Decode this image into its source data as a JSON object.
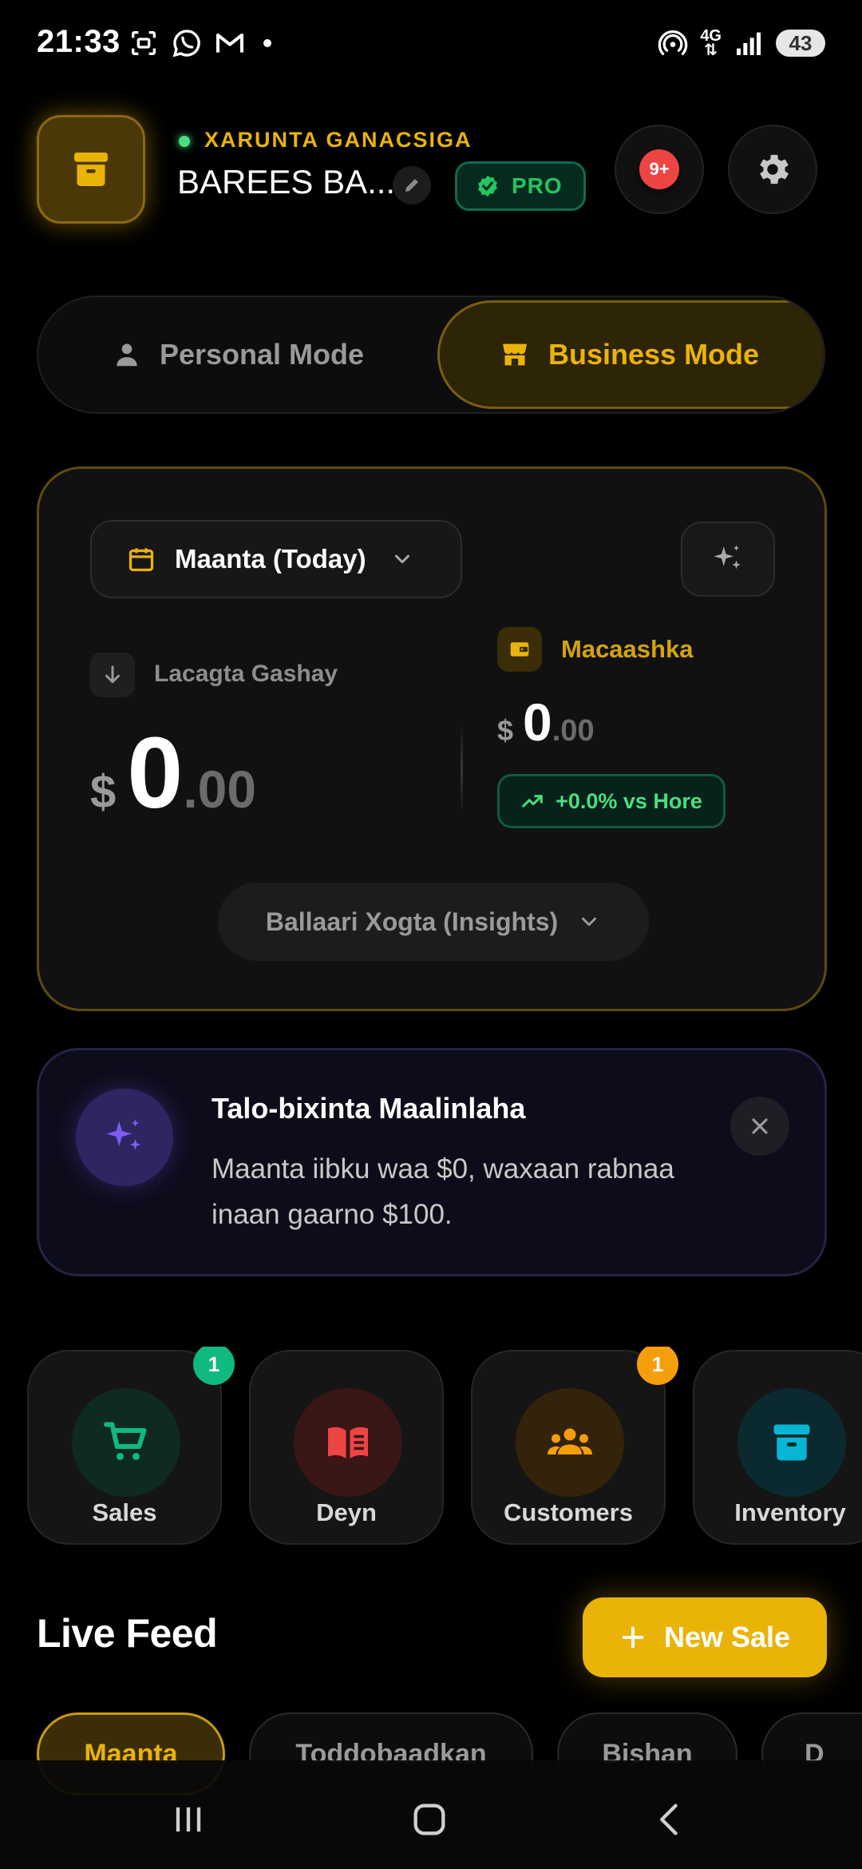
{
  "status_bar": {
    "time": "21:33",
    "network": "4G",
    "battery": "43"
  },
  "header": {
    "hub_label": "XARUNTA GANACSIGA",
    "business_name": "BAREES BA...",
    "pro_badge": "PRO",
    "notification_count": "9+"
  },
  "mode_toggle": {
    "personal": "Personal Mode",
    "business": "Business Mode",
    "active": "business"
  },
  "summary": {
    "date_filter": "Maanta (Today)",
    "income": {
      "label": "Lacagta Gashay",
      "currency": "$",
      "amount_int": "0",
      "amount_dec": ".00"
    },
    "wallet": {
      "label": "Macaashka",
      "currency": "$",
      "amount_int": "0",
      "amount_dec": ".00",
      "trend": "+0.0% vs Hore"
    },
    "insights_button": "Ballaari Xogta (Insights)"
  },
  "forecast": {
    "title": "Talo-bixinta Maalinlaha",
    "body": "Maanta iibku waa $0, waxaan rabnaa inaan gaarno $100."
  },
  "quick_actions": [
    {
      "label": "Sales",
      "icon": "cart-icon",
      "badge": "1",
      "badge_color": "#10b981",
      "circle_color": "#0f2a20",
      "icon_color": "#10b981"
    },
    {
      "label": "Deyn",
      "icon": "book-icon",
      "badge": "",
      "badge_color": "",
      "circle_color": "#3a1616",
      "icon_color": "#ef4444"
    },
    {
      "label": "Customers",
      "icon": "users-icon",
      "badge": "1",
      "badge_color": "#f59e0b",
      "circle_color": "#33230a",
      "icon_color": "#f59e0b"
    },
    {
      "label": "Inventory",
      "icon": "archive-icon",
      "badge": "",
      "badge_color": "",
      "circle_color": "#0a2a30",
      "icon_color": "#06b6d4"
    }
  ],
  "live_feed": {
    "title": "Live Feed",
    "new_sale_button": "New Sale",
    "tabs": [
      "Maanta",
      "Toddobaadkan",
      "Bishan",
      "D"
    ]
  },
  "colors": {
    "accent": "#eab308",
    "success": "#22c55e",
    "danger": "#ef4444",
    "background": "#000000"
  }
}
